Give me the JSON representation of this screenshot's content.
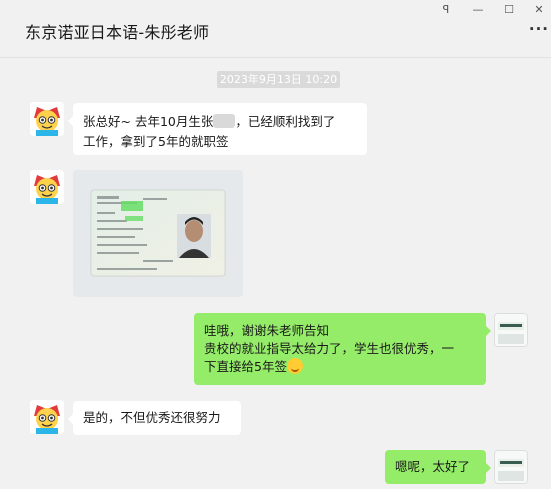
{
  "window": {
    "title": "东京诺亚日本语-朱彤老师",
    "pin_glyph": "ꟼ",
    "minimize_glyph": "—",
    "maximize_glyph": "☐",
    "close_glyph": "✕",
    "more_glyph": "···"
  },
  "chat": {
    "timestamp": "2023年9月13日 10:20",
    "messages": [
      {
        "side": "left",
        "type": "text",
        "text_before": "张总好~ 去年10月生张",
        "text_after": "，已经顺利找到了",
        "text_line2": "工作，拿到了5年的就职签"
      },
      {
        "side": "left",
        "type": "image",
        "image_desc": "residence card photo"
      },
      {
        "side": "right",
        "type": "text",
        "line1": "哇哦，谢谢朱老师告知",
        "line2": "贵校的就业指导太给力了，学生也很优秀，一",
        "line3": "下直接给5年签"
      },
      {
        "side": "left",
        "type": "text",
        "text": "是的，不但优秀还很努力"
      },
      {
        "side": "right",
        "type": "text",
        "text": "嗯呢，太好了"
      }
    ]
  },
  "colors": {
    "incoming_bubble": "#ffffff",
    "outgoing_bubble": "#95ec69",
    "background": "#f1f1f1"
  }
}
